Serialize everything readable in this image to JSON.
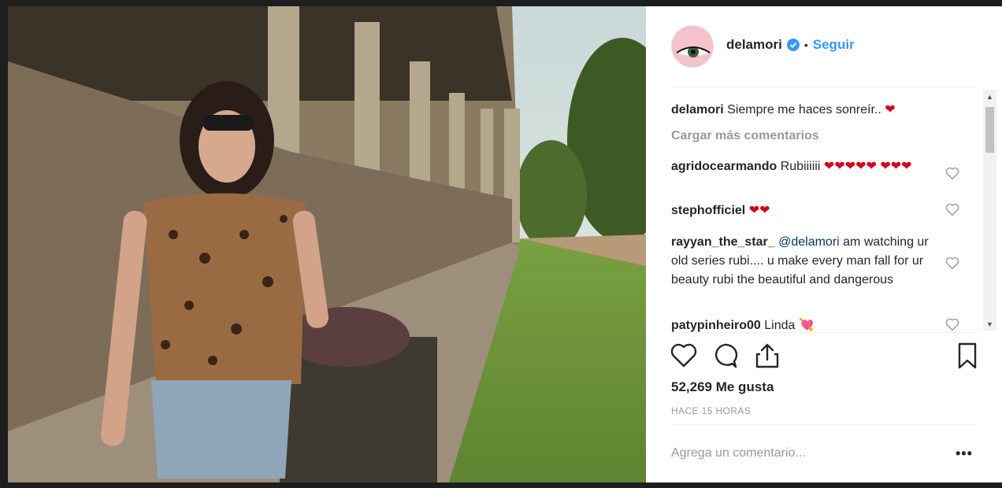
{
  "post": {
    "username": "delamori",
    "follow_label": "Seguir",
    "separator": "•",
    "caption": {
      "user": "delamori",
      "text": "Siempre me haces sonreír..",
      "emoji": "❤"
    },
    "load_more_label": "Cargar más comentarios",
    "comments": [
      {
        "user": "agridocearmando",
        "text": "Rubiiiiii",
        "emoji": "❤❤❤❤❤ ❤❤❤"
      },
      {
        "user": "stephofficiel",
        "text": "",
        "emoji": "❤❤"
      },
      {
        "user": "rayyan_the_star_",
        "mention": "@delamori",
        "text": "am watching ur old series rubi.... u make every man fall for ur beauty rubi the beautiful and dangerous",
        "emoji": ""
      },
      {
        "user": "patypinheiro00",
        "text": "Linda",
        "emoji": "💘"
      }
    ],
    "likes_label": "52,269 Me gusta",
    "time_label": "HACE 15 HORAS",
    "comment_placeholder": "Agrega un comentario...",
    "more_label": "•••"
  },
  "icons": {
    "verified": "verified-badge-icon",
    "like": "heart-outline-icon",
    "comment": "speech-bubble-icon",
    "share": "share-upload-icon",
    "save": "bookmark-icon"
  },
  "colors": {
    "link_blue": "#3897f0",
    "heart_red": "#d0021b",
    "muted_gray": "#999999",
    "text_dark": "#262626"
  }
}
